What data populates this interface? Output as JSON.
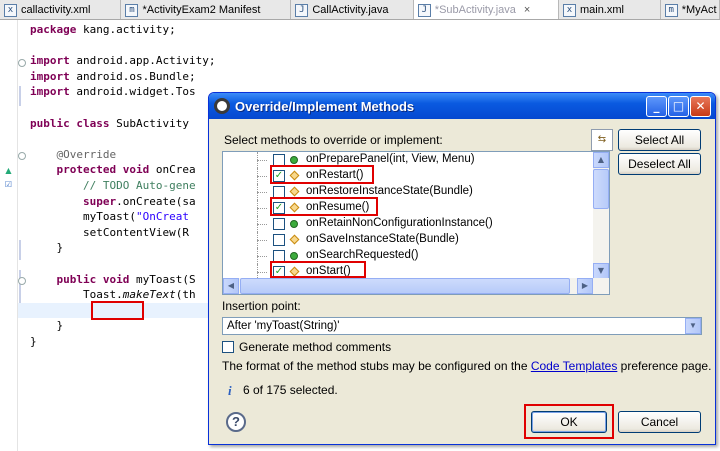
{
  "editor_tabs": [
    {
      "label": "callactivity.xml",
      "icon": "x"
    },
    {
      "label": "*ActivityExam2 Manifest",
      "icon": "m"
    },
    {
      "label": "CallActivity.java",
      "icon": "J"
    },
    {
      "label": "*SubActivity.java",
      "icon": "J",
      "close": "×"
    },
    {
      "label": "main.xml",
      "icon": "x"
    },
    {
      "label": "*MyAct",
      "icon": "m"
    }
  ],
  "code": {
    "line1_kw": "package",
    "line1_rest": " kang.activity;",
    "import_kw": "import",
    "import1": " android.app.Activity;",
    "import2": " android.os.Bundle;",
    "import3": " android.widget.Tos",
    "class_kw": "public class",
    "class_rest": " SubActivity",
    "annotation": "@Override",
    "oncreate_kw": "protected void",
    "oncreate_rest": " onCrea",
    "todo": "// TODO Auto-gene",
    "super_kw": "super",
    "super_rest": ".onCreate(sa",
    "mytoast_call": "myToast(",
    "mytoast_str": "\"OnCreat",
    "setcontent": "setContentView(R",
    "close_brace": "}",
    "mytoast_kw": "public void",
    "mytoast_rest": " myToast(S",
    "toast": "Toast.",
    "maketext": "makeText",
    "maketext_rest": "(th",
    "class_close": "}"
  },
  "dialog": {
    "title": "Override/Implement Methods",
    "select_label": "Select methods to override or implement:",
    "select_all": "Select All",
    "deselect_all": "Deselect All",
    "methods": [
      {
        "label": "onPreparePanel(int, View, Menu)",
        "checked": false,
        "icon": "green"
      },
      {
        "label": "onRestart()",
        "checked": true,
        "icon": "diamond"
      },
      {
        "label": "onRestoreInstanceState(Bundle)",
        "checked": false,
        "icon": "diamond"
      },
      {
        "label": "onResume()",
        "checked": true,
        "icon": "diamond"
      },
      {
        "label": "onRetainNonConfigurationInstance()",
        "checked": false,
        "icon": "green"
      },
      {
        "label": "onSaveInstanceState(Bundle)",
        "checked": false,
        "icon": "diamond"
      },
      {
        "label": "onSearchRequested()",
        "checked": false,
        "icon": "green"
      },
      {
        "label": "onStart()",
        "checked": true,
        "icon": "diamond"
      }
    ],
    "insertion_label": "Insertion point:",
    "insertion_value": "After 'myToast(String)'",
    "generate_comments": "Generate method comments",
    "format_text_before": "The format of the method stubs may be configured on the ",
    "format_link": "Code Templates",
    "format_text_after": " preference page.",
    "selected_count": "6 of 175 selected.",
    "ok": "OK",
    "cancel": "Cancel",
    "help": "?"
  },
  "colors": {
    "highlight_red": "#e00000",
    "title_blue": "#0a5ae0",
    "keyword": "#7f0055",
    "comment": "#3f7f5f"
  }
}
